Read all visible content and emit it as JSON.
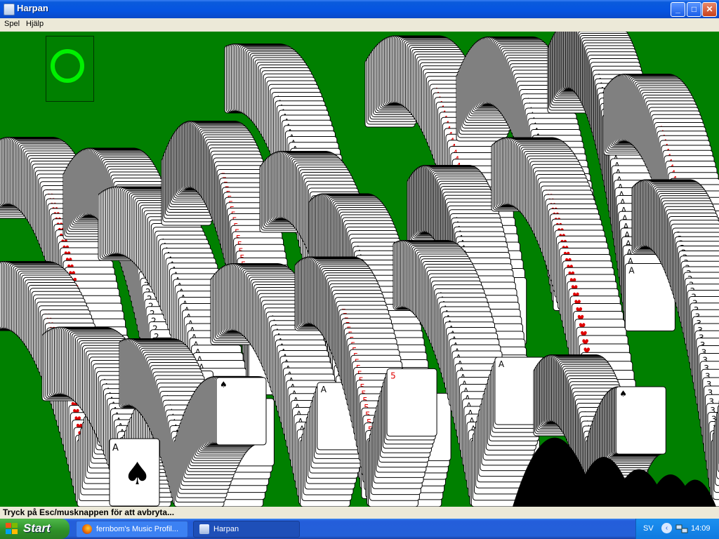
{
  "window": {
    "title": "Harpan",
    "minimize_glyph": "_",
    "maximize_glyph": "□",
    "close_glyph": "✕"
  },
  "menu": {
    "items": [
      "Spel",
      "Hjälp"
    ]
  },
  "game": {
    "card_symbols": [
      "A",
      "2",
      "3",
      "4",
      "5",
      "♠",
      "♥"
    ],
    "colors": {
      "felt": "#008000",
      "foundation_ring": "#00f000",
      "red_suit": "#e00000"
    },
    "shown_card": {
      "rank": "A",
      "suit": "♠"
    }
  },
  "status": {
    "text": "Tryck på Esc/musknappen för att avbryta..."
  },
  "taskbar": {
    "start_label": "Start",
    "tasks": [
      {
        "label": "fernbom's Music Profil...",
        "icon": "firefox-icon"
      },
      {
        "label": "Harpan",
        "icon": "app-window-icon"
      }
    ],
    "tray": {
      "language": "SV",
      "clock": "14:09"
    }
  }
}
